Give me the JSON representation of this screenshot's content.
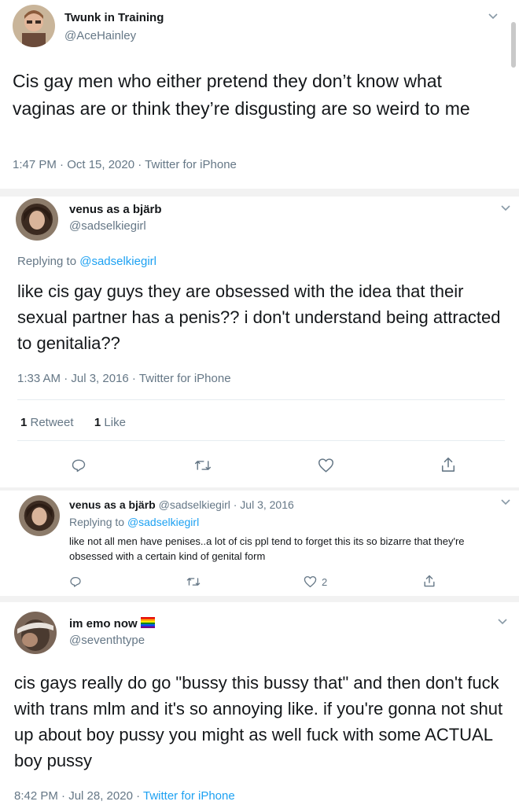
{
  "tweet1": {
    "name": "Twunk in Training",
    "handle": "@AceHainley",
    "text": "Cis gay men who either pretend they don’t know what vaginas are or think they’re disgusting are so weird to me",
    "meta": "1:47 PM · Oct 15, 2020 · ",
    "source": "Twitter for iPhone"
  },
  "tweet2": {
    "name": "venus as a bjärb",
    "handle": "@sadselkiegirl",
    "replying_prefix": "Replying to ",
    "replying_mention": "@sadselkiegirl",
    "text": "like cis gay guys they are obsessed with the idea that their sexual partner has a penis?? i don't understand being attracted to genitalia??",
    "meta": "1:33 AM · Jul 3, 2016 · ",
    "source": "Twitter for iPhone",
    "retweets_count": "1",
    "retweets_label": " Retweet",
    "likes_count": "1",
    "likes_label": " Like"
  },
  "tweet3": {
    "name": "venus as a bjärb",
    "handle_date": " @sadselkiegirl · Jul 3, 2016",
    "replying_prefix": "Replying to ",
    "replying_mention": "@sadselkiegirl",
    "text": "like not all men have penises..a lot of cis ppl tend to forget this its so bizarre that they're obsessed with a certain kind of genital form",
    "like_count": "2"
  },
  "tweet4": {
    "name": "im emo now",
    "handle": "@seventhtype",
    "text": "cis gays really do go \"bussy this bussy that\" and then don't fuck with trans mlm and it's so annoying like. if you're gonna not shut up about boy pussy you might as well fuck with some ACTUAL boy pussy",
    "meta": "8:42 PM · Jul 28, 2020 · ",
    "source": "Twitter for iPhone"
  },
  "icons": {
    "reply": "reply-icon",
    "retweet": "retweet-icon",
    "like": "heart-icon",
    "share": "share-icon",
    "menu": "chevron-down-icon",
    "flag": "rainbow-flag-icon"
  },
  "colors": {
    "text": "#14171a",
    "secondary": "#657786",
    "link": "#1da1f2",
    "divider": "#e6ecf0",
    "separator": "#f2f2f2"
  }
}
